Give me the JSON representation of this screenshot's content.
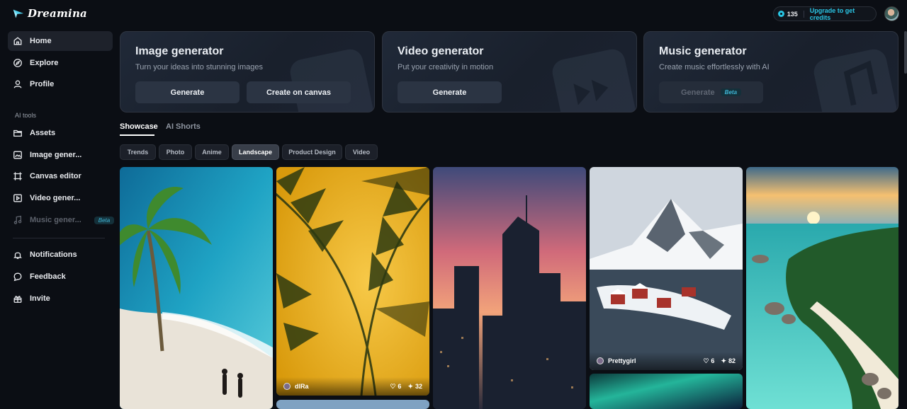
{
  "brand": {
    "name": "Dreamina",
    "accent": "#2ac7e6"
  },
  "nav": {
    "primary": [
      {
        "label": "Home",
        "icon": "home-icon",
        "active": true
      },
      {
        "label": "Explore",
        "icon": "compass-icon"
      },
      {
        "label": "Profile",
        "icon": "user-icon"
      }
    ],
    "tools_label": "AI tools",
    "tools": [
      {
        "label": "Assets",
        "icon": "folder-icon"
      },
      {
        "label": "Image gener...",
        "icon": "image-icon"
      },
      {
        "label": "Canvas editor",
        "icon": "canvas-icon"
      },
      {
        "label": "Video gener...",
        "icon": "video-icon"
      },
      {
        "label": "Music gener...",
        "icon": "music-icon",
        "disabled": true,
        "badge": "Beta"
      }
    ],
    "secondary": [
      {
        "label": "Notifications",
        "icon": "bell-icon"
      },
      {
        "label": "Feedback",
        "icon": "chat-icon"
      },
      {
        "label": "Invite",
        "icon": "gift-icon"
      }
    ]
  },
  "header": {
    "credits": "135",
    "upgrade_label": "Upgrade to get credits"
  },
  "cards": [
    {
      "title": "Image generator",
      "desc": "Turn your ideas into stunning images",
      "buttons": [
        "Generate",
        "Create on canvas"
      ]
    },
    {
      "title": "Video generator",
      "desc": "Put your creativity in motion",
      "buttons": [
        "Generate"
      ]
    },
    {
      "title": "Music generator",
      "desc": "Create music effortlessly with AI",
      "buttons": [
        "Generate"
      ],
      "badge": "Beta"
    }
  ],
  "tabs": [
    "Showcase",
    "AI Shorts"
  ],
  "active_tab": "Showcase",
  "chips": [
    "Trends",
    "Photo",
    "Anime",
    "Landscape",
    "Product Design",
    "Video"
  ],
  "active_chip": "Landscape",
  "gallery": {
    "items": [
      {
        "subject": "palm tree beach couple"
      },
      {
        "subject": "palm leaf shadow on yellow",
        "author": "dlRa",
        "likes": "6",
        "uses": "32"
      },
      {
        "subject": "city skyline at sunset"
      },
      {
        "subject": "snowy fishing village and mountain",
        "author": "Prettygirl",
        "likes": "6",
        "uses": "82"
      },
      {
        "subject": "tropical island at sunset"
      }
    ]
  }
}
